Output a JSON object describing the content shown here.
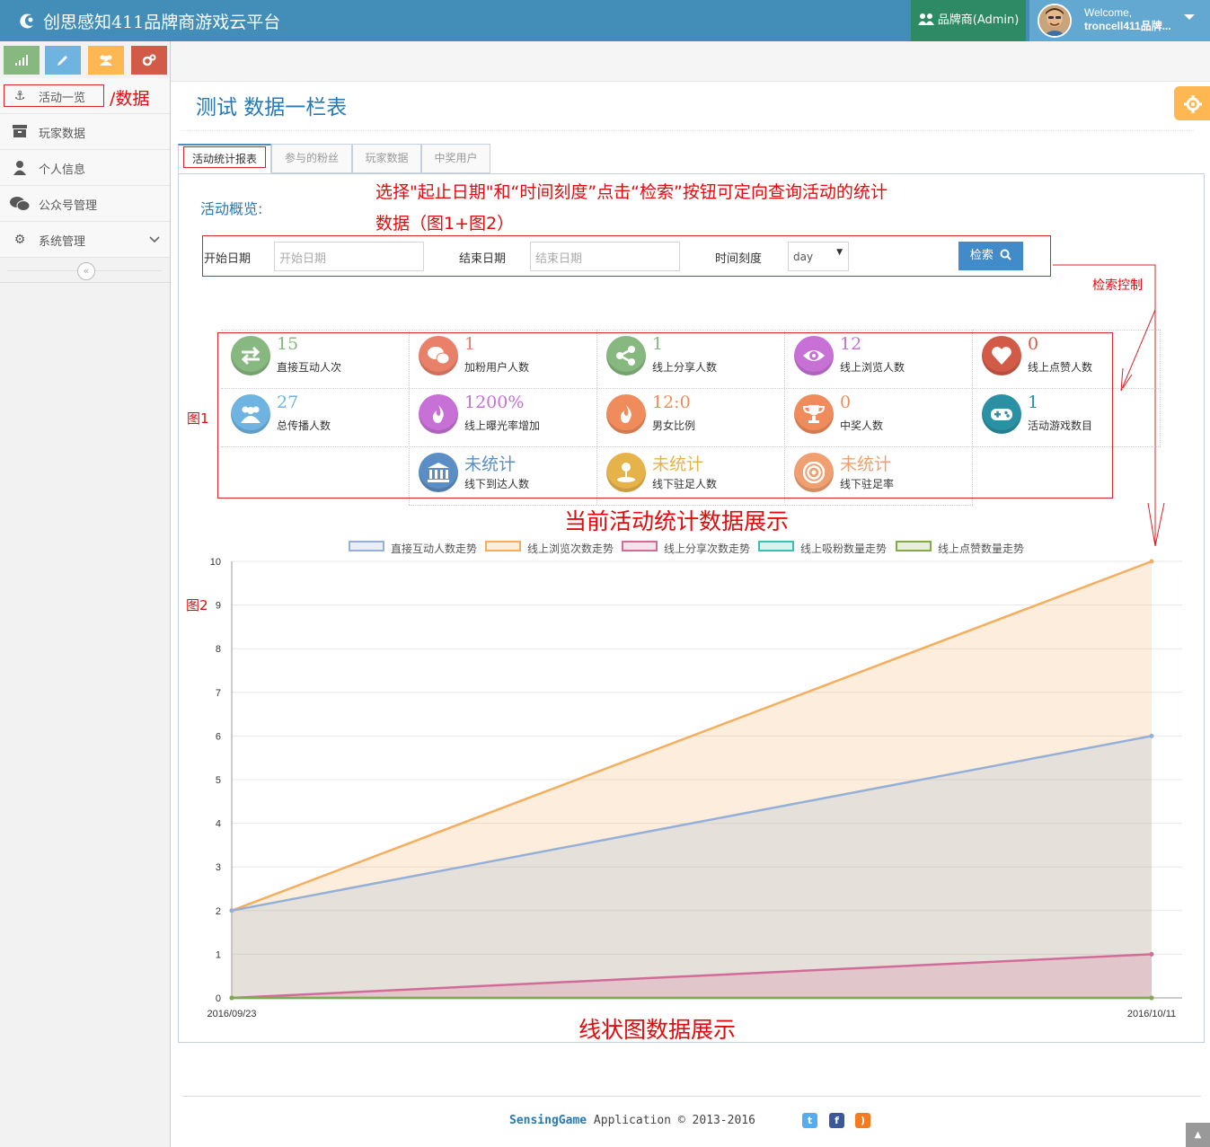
{
  "navbar": {
    "brand": "创思感知411品牌商游戏云平台",
    "role": "品牌商(Admin)",
    "welcome_line1": "Welcome,",
    "welcome_line2": "troncell411品牌..."
  },
  "sidebar": {
    "shortcut_colors": [
      "#87b87f",
      "#6fb3e0",
      "#ffb752",
      "#d15b47"
    ],
    "items": [
      {
        "label": "活动一览",
        "icon": "anchor-icon"
      },
      {
        "label": "玩家数据",
        "icon": "archive-icon"
      },
      {
        "label": "个人信息",
        "icon": "user-icon"
      },
      {
        "label": "公众号管理",
        "icon": "wechat-icon"
      },
      {
        "label": "系统管理",
        "icon": "cog-icon"
      }
    ],
    "annotation": "/数据"
  },
  "page": {
    "title": "测试 数据一栏表"
  },
  "tabs": [
    "活动统计报表",
    "参与的粉丝",
    "玩家数据",
    "中奖用户"
  ],
  "overview_label": "活动概览:",
  "annotations": {
    "instruction_line1": "选择\"起止日期\"和“时间刻度”点击“检索”按钮可定向查询活动的统计",
    "instruction_line2": "数据（图1+图2）",
    "search_control": "检索控制",
    "fig1": "图1",
    "fig2": "图2",
    "stats_caption": "当前活动统计数据展示",
    "chart_caption": "线状图数据展示"
  },
  "filters": {
    "start_label": "开始日期",
    "start_placeholder": "开始日期",
    "end_label": "结束日期",
    "end_placeholder": "结束日期",
    "scale_label": "时间刻度",
    "scale_value": "day",
    "search_button": "检索"
  },
  "stats": [
    {
      "value": "15",
      "label": "直接互动人次",
      "color": "#87b87f",
      "icon": "exchange-icon"
    },
    {
      "value": "1",
      "label": "加粉用户人数",
      "color": "#e8806a",
      "icon": "wechat-icon"
    },
    {
      "value": "1",
      "label": "线上分享人数",
      "color": "#87b87f",
      "icon": "share-icon"
    },
    {
      "value": "12",
      "label": "线上浏览人数",
      "color": "#c770d5",
      "icon": "eye-icon"
    },
    {
      "value": "0",
      "label": "线上点赞人数",
      "color": "#d15b47",
      "icon": "heart-icon"
    },
    {
      "value": "27",
      "label": "总传播人数",
      "color": "#6fb3e0",
      "icon": "users-icon"
    },
    {
      "value": "1200%",
      "label": "线上曝光率增加",
      "color": "#c770d5",
      "icon": "fire-icon"
    },
    {
      "value": "12:0",
      "label": "男女比例",
      "color": "#f08c5c",
      "icon": "fire-icon"
    },
    {
      "value": "0",
      "label": "中奖人数",
      "color": "#f08c5c",
      "icon": "trophy-icon"
    },
    {
      "value": "1",
      "label": "活动游戏数目",
      "color": "#2a91a4",
      "icon": "gamepad-icon"
    },
    {
      "value": "未统计",
      "label": "线下到达人数",
      "color": "#5b8ec5",
      "icon": "bank-icon"
    },
    {
      "value": "未统计",
      "label": "线下驻足人数",
      "color": "#e6b34a",
      "icon": "user-pin-icon"
    },
    {
      "value": "未统计",
      "label": "线下驻足率",
      "color": "#f0a070",
      "icon": "target-icon"
    }
  ],
  "chart_data": {
    "type": "area",
    "x": [
      "2016/09/23",
      "2016/10/11"
    ],
    "ylim": [
      0,
      10
    ],
    "yticks": [
      0,
      1,
      2,
      3,
      4,
      5,
      6,
      7,
      8,
      9,
      10
    ],
    "grid": true,
    "legend_position": "top",
    "series": [
      {
        "name": "直接互动人数走势",
        "values": [
          2,
          6
        ],
        "color": "#94b0d8"
      },
      {
        "name": "线上浏览次数走势",
        "values": [
          2,
          10
        ],
        "color": "#f5ad5e"
      },
      {
        "name": "线上分享次数走势",
        "values": [
          0,
          1
        ],
        "color": "#d16c99"
      },
      {
        "name": "线上吸粉数量走势",
        "values": [
          0,
          0
        ],
        "color": "#3cc0b0"
      },
      {
        "name": "线上点赞数量走势",
        "values": [
          0,
          0
        ],
        "color": "#85a94a"
      }
    ]
  },
  "footer": {
    "brand": "SensingGame",
    "text": " Application © 2013-2016"
  }
}
